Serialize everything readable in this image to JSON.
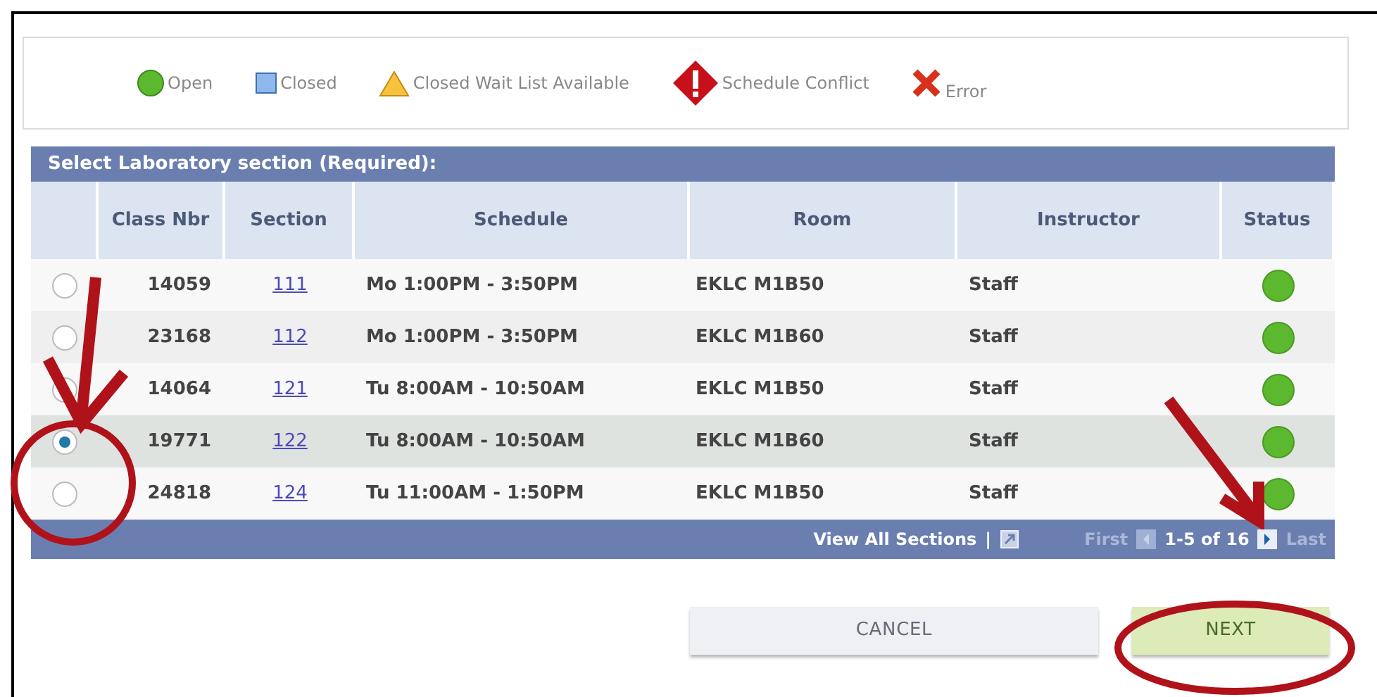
{
  "legend": [
    {
      "kind": "open",
      "label": "Open"
    },
    {
      "kind": "closed",
      "label": "Closed"
    },
    {
      "kind": "waitlist",
      "label": "Closed Wait List Available"
    },
    {
      "kind": "conflict",
      "label": "Schedule Conflict"
    },
    {
      "kind": "error",
      "label": "Error"
    }
  ],
  "table": {
    "title": "Select Laboratory section (Required):",
    "columns": [
      "Class Nbr",
      "Section",
      "Schedule",
      "Room",
      "Instructor",
      "Status"
    ],
    "rows": [
      {
        "selected": false,
        "class_nbr": "14059",
        "section": "111",
        "schedule": "Mo 1:00PM - 3:50PM",
        "room": "EKLC M1B50",
        "instructor": "Staff",
        "status": {
          "kind": "open"
        }
      },
      {
        "selected": false,
        "class_nbr": "23168",
        "section": "112",
        "schedule": "Mo 1:00PM - 3:50PM",
        "room": "EKLC M1B60",
        "instructor": "Staff",
        "status": {
          "kind": "open"
        }
      },
      {
        "selected": false,
        "class_nbr": "14064",
        "section": "121",
        "schedule": "Tu 8:00AM - 10:50AM",
        "room": "EKLC M1B50",
        "instructor": "Staff",
        "status": {
          "kind": "open"
        }
      },
      {
        "selected": true,
        "class_nbr": "19771",
        "section": "122",
        "schedule": "Tu 8:00AM - 10:50AM",
        "room": "EKLC M1B60",
        "instructor": "Staff",
        "status": {
          "kind": "open"
        }
      },
      {
        "selected": false,
        "class_nbr": "24818",
        "section": "124",
        "schedule": "Tu 11:00AM - 1:50PM",
        "room": "EKLC M1B50",
        "instructor": "Staff",
        "status": {
          "kind": "open"
        }
      }
    ],
    "footer": {
      "view_all": "View All Sections",
      "separator": "|",
      "first": "First",
      "range": "1-5 of 16",
      "last": "Last"
    }
  },
  "buttons": [
    {
      "kind": "cancel",
      "label": "CANCEL"
    },
    {
      "kind": "next",
      "label": "NEXT"
    }
  ]
}
